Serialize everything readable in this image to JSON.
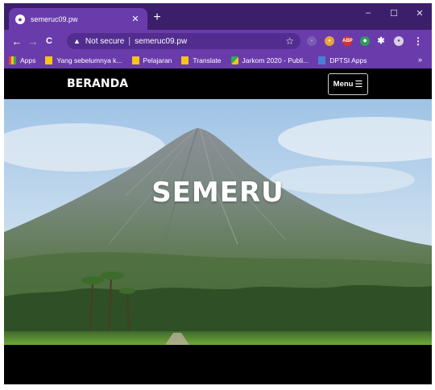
{
  "browser": {
    "tab": {
      "title": "semeruc09.pw",
      "close": "✕"
    },
    "new_tab": "+",
    "window_controls": {
      "minimize": "–",
      "maximize": "☐",
      "close": "✕"
    },
    "nav": {
      "back": "←",
      "forward": "→",
      "reload": "C"
    },
    "omnibox": {
      "status": "Not secure",
      "separator": "|",
      "url": "semeruc09.pw"
    },
    "extensions": [
      {
        "name": "abp",
        "label": "ABP",
        "color": "#d9302a"
      }
    ],
    "bookmarks": [
      {
        "label": "Apps",
        "color": "#e8453c"
      },
      {
        "label": "Yang sebelumnya k...",
        "color": "#f5c518"
      },
      {
        "label": "Pelajaran",
        "color": "#f5c518"
      },
      {
        "label": "Translate",
        "color": "#f5c518"
      },
      {
        "label": "Jarkom 2020 - Publi...",
        "color": "#34a853"
      },
      {
        "label": "DPTSI Apps",
        "color": "#4a7fd4"
      }
    ],
    "bookmarks_more": "»",
    "colors": {
      "frame": "#3b1f6b",
      "toolbar": "#6a3cab"
    }
  },
  "site": {
    "brand": "BERANDA",
    "menu_label": "Menu",
    "menu_icon": "☰",
    "hero_title": "SEMERU"
  }
}
